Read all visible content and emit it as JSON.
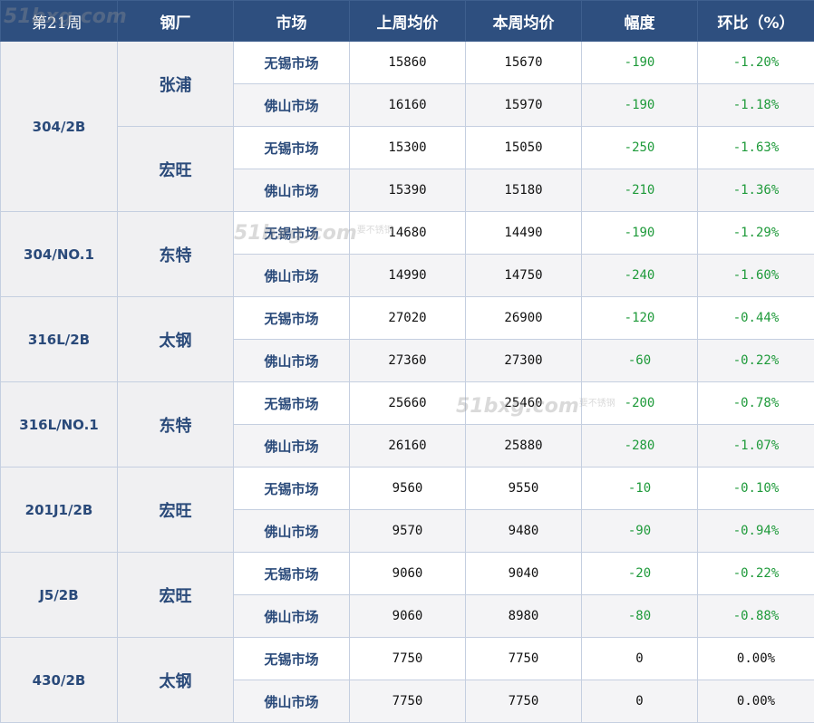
{
  "header": {
    "week": "第21周",
    "mill": "钢厂",
    "market": "市场",
    "last_avg": "上周均价",
    "this_avg": "本周均价",
    "change": "幅度",
    "pct": "环比（%）"
  },
  "groups": [
    {
      "grade": "304/2B",
      "mills": [
        {
          "name": "张浦",
          "rows": [
            {
              "market": "无锡市场",
              "last": "15860",
              "this": "15670",
              "change": "-190",
              "pct": "-1.20%"
            },
            {
              "market": "佛山市场",
              "last": "16160",
              "this": "15970",
              "change": "-190",
              "pct": "-1.18%"
            }
          ]
        },
        {
          "name": "宏旺",
          "rows": [
            {
              "market": "无锡市场",
              "last": "15300",
              "this": "15050",
              "change": "-250",
              "pct": "-1.63%"
            },
            {
              "market": "佛山市场",
              "last": "15390",
              "this": "15180",
              "change": "-210",
              "pct": "-1.36%"
            }
          ]
        }
      ]
    },
    {
      "grade": "304/NO.1",
      "mills": [
        {
          "name": "东特",
          "rows": [
            {
              "market": "无锡市场",
              "last": "14680",
              "this": "14490",
              "change": "-190",
              "pct": "-1.29%"
            },
            {
              "market": "佛山市场",
              "last": "14990",
              "this": "14750",
              "change": "-240",
              "pct": "-1.60%"
            }
          ]
        }
      ]
    },
    {
      "grade": "316L/2B",
      "mills": [
        {
          "name": "太钢",
          "rows": [
            {
              "market": "无锡市场",
              "last": "27020",
              "this": "26900",
              "change": "-120",
              "pct": "-0.44%"
            },
            {
              "market": "佛山市场",
              "last": "27360",
              "this": "27300",
              "change": "-60",
              "pct": "-0.22%"
            }
          ]
        }
      ]
    },
    {
      "grade": "316L/NO.1",
      "mills": [
        {
          "name": "东特",
          "rows": [
            {
              "market": "无锡市场",
              "last": "25660",
              "this": "25460",
              "change": "-200",
              "pct": "-0.78%"
            },
            {
              "market": "佛山市场",
              "last": "26160",
              "this": "25880",
              "change": "-280",
              "pct": "-1.07%"
            }
          ]
        }
      ]
    },
    {
      "grade": "201J1/2B",
      "mills": [
        {
          "name": "宏旺",
          "rows": [
            {
              "market": "无锡市场",
              "last": "9560",
              "this": "9550",
              "change": "-10",
              "pct": "-0.10%"
            },
            {
              "market": "佛山市场",
              "last": "9570",
              "this": "9480",
              "change": "-90",
              "pct": "-0.94%"
            }
          ]
        }
      ]
    },
    {
      "grade": "J5/2B",
      "mills": [
        {
          "name": "宏旺",
          "rows": [
            {
              "market": "无锡市场",
              "last": "9060",
              "this": "9040",
              "change": "-20",
              "pct": "-0.22%"
            },
            {
              "market": "佛山市场",
              "last": "9060",
              "this": "8980",
              "change": "-80",
              "pct": "-0.88%"
            }
          ]
        }
      ]
    },
    {
      "grade": "430/2B",
      "mills": [
        {
          "name": "太钢",
          "rows": [
            {
              "market": "无锡市场",
              "last": "7750",
              "this": "7750",
              "change": "0",
              "pct": "0.00%"
            },
            {
              "market": "佛山市场",
              "last": "7750",
              "this": "7750",
              "change": "0",
              "pct": "0.00%"
            }
          ]
        }
      ]
    }
  ],
  "watermark": {
    "site": "51bxg.com",
    "tag": "要不锈钢"
  },
  "colors": {
    "header_bg": "#2e4f7f",
    "label_text": "#2a4a7a",
    "negative": "#1e9a3a"
  }
}
